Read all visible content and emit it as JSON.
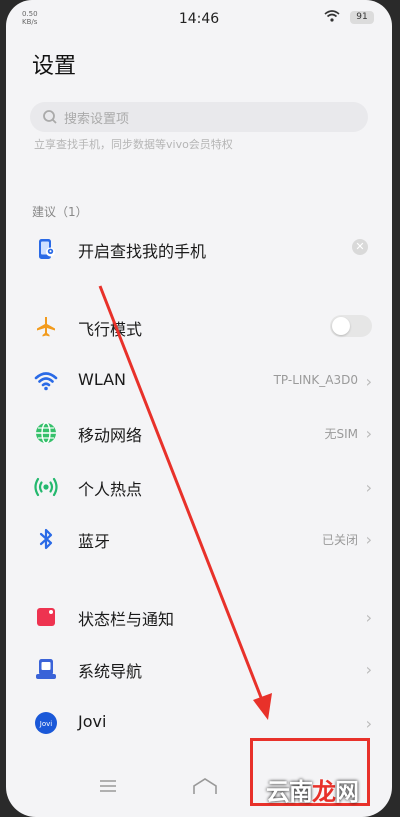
{
  "status": {
    "speed": "0.50",
    "speed_unit": "KB/s",
    "time": "14:46",
    "battery": "91"
  },
  "title": "设置",
  "search": {
    "placeholder": "搜索设置项"
  },
  "promo": "立享查找手机，同步数据等vivo会员特权",
  "suggest": {
    "label": "建议（1）",
    "item": "开启查找我的手机"
  },
  "items": [
    {
      "label": "飞行模式",
      "value": ""
    },
    {
      "label": "WLAN",
      "value": "TP-LINK_A3D0"
    },
    {
      "label": "移动网络",
      "value": "无SIM"
    },
    {
      "label": "个人热点",
      "value": ""
    },
    {
      "label": "蓝牙",
      "value": "已关闭"
    },
    {
      "label": "状态栏与通知",
      "value": ""
    },
    {
      "label": "系统导航",
      "value": ""
    },
    {
      "label": "Jovi",
      "value": ""
    }
  ],
  "airplane_on": false,
  "watermark": {
    "a": "云南",
    "b": "龙",
    "c": "网"
  },
  "colors": {
    "accent": "#2a6ae6",
    "airplane": "#f29b1d",
    "wifi": "#2a6ae6",
    "mobile": "#34c06a",
    "hotspot": "#24b86e",
    "bluetooth": "#2a6ae6",
    "statusbar": "#ee3350",
    "nav": "#3a63d8",
    "annotation": "#e8312a"
  },
  "icons": [
    "search-icon",
    "phone-locate-icon",
    "airplane-icon",
    "wifi-icon",
    "globe-icon",
    "hotspot-icon",
    "bluetooth-icon",
    "statusbar-icon",
    "navigation-icon",
    "jovi-icon",
    "chevron-right-icon",
    "close-icon",
    "menu-icon",
    "home-icon"
  ]
}
